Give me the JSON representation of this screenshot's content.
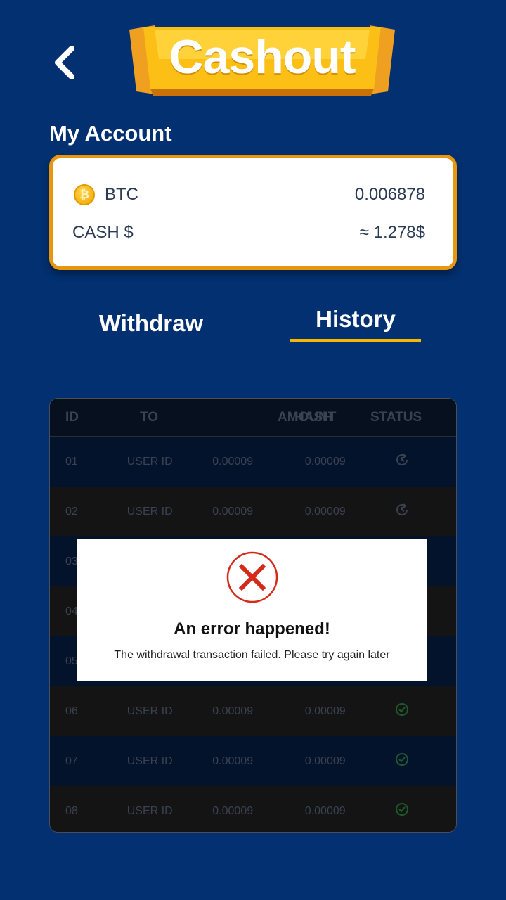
{
  "header": {
    "title": "Cashout",
    "back_icon": "chevron-left-icon",
    "banner_color": "#f5b800"
  },
  "account": {
    "section_title": "My Account",
    "rows": [
      {
        "icon": "bitcoin-coin-icon",
        "icon_glyph": "₿",
        "label": "BTC",
        "value": "0.006878"
      },
      {
        "label": "CASH $",
        "value": "≈ 1.278$"
      }
    ]
  },
  "tabs": {
    "withdraw": "Withdraw",
    "history": "History",
    "active": "History",
    "accent_color": "#f5b800"
  },
  "history_table": {
    "headers": [
      "ID",
      "TO",
      "AMOUNT",
      "HASH",
      "STATUS"
    ],
    "rows": [
      {
        "id": "01",
        "to": "USER ID",
        "amount": "0.00009",
        "hash": "0.00009",
        "status": "pending"
      },
      {
        "id": "02",
        "to": "USER ID",
        "amount": "0.00009",
        "hash": "0.00009",
        "status": "pending"
      },
      {
        "id": "03",
        "to": "",
        "amount": "",
        "hash": "",
        "status": ""
      },
      {
        "id": "04",
        "to": "",
        "amount": "",
        "hash": "",
        "status": ""
      },
      {
        "id": "05",
        "to": "",
        "amount": "",
        "hash": "",
        "status": ""
      },
      {
        "id": "06",
        "to": "USER ID",
        "amount": "0.00009",
        "hash": "0.00009",
        "status": "success"
      },
      {
        "id": "07",
        "to": "USER ID",
        "amount": "0.00009",
        "hash": "0.00009",
        "status": "success"
      },
      {
        "id": "08",
        "to": "USER ID",
        "amount": "0.00009",
        "hash": "0.00009",
        "status": "success"
      }
    ]
  },
  "modal": {
    "icon": "error-x-icon",
    "title": "An error happened!",
    "message": "The withdrawal transaction failed. Please try again later",
    "icon_color": "#d52a1a"
  }
}
